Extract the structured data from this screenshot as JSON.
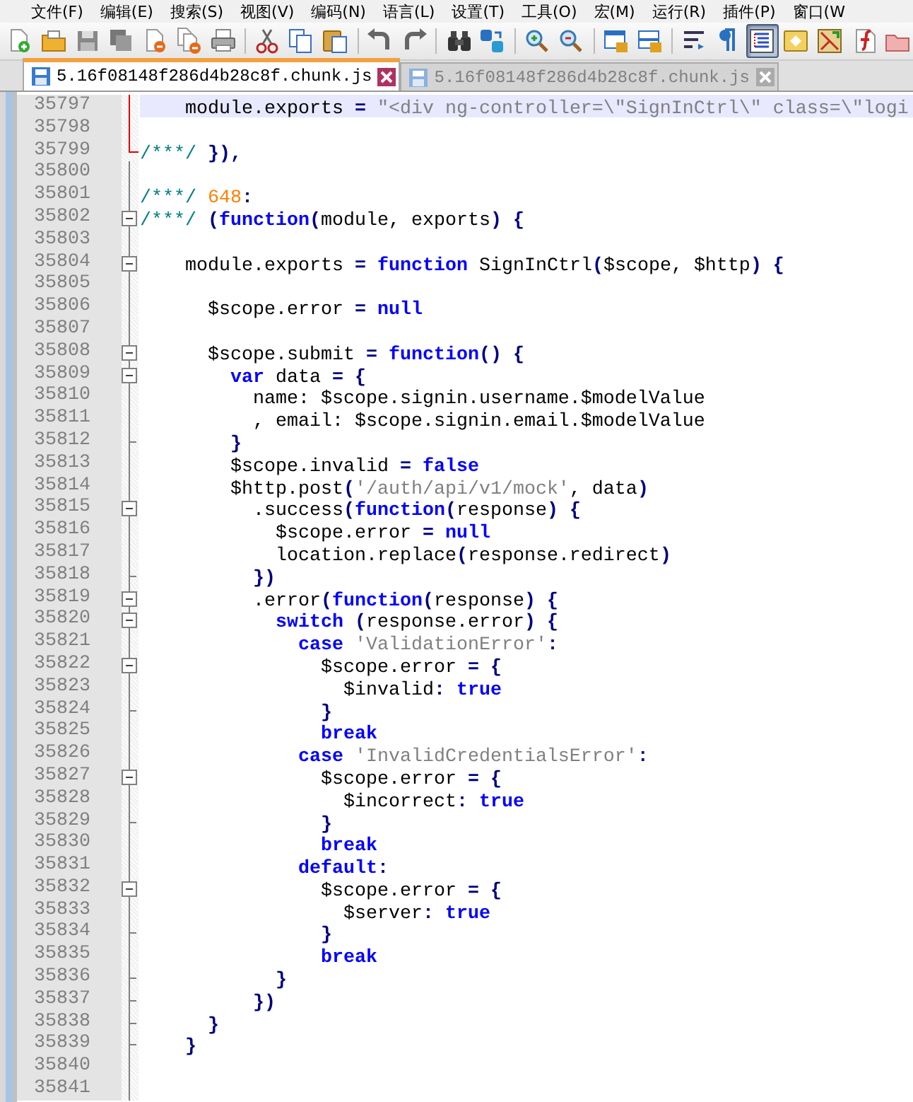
{
  "menu": [
    "文件(F)",
    "编辑(E)",
    "搜索(S)",
    "视图(V)",
    "编码(N)",
    "语言(L)",
    "设置(T)",
    "工具(O)",
    "宏(M)",
    "运行(R)",
    "插件(P)",
    "窗口(W"
  ],
  "toolbar": [
    {
      "kind": "new",
      "on": false
    },
    {
      "kind": "open",
      "on": false
    },
    {
      "kind": "save",
      "on": false
    },
    {
      "kind": "save_all",
      "on": false
    },
    {
      "kind": "close",
      "on": false
    },
    {
      "kind": "close_all",
      "on": false
    },
    {
      "kind": "print",
      "on": false
    },
    {
      "kind": "sep"
    },
    {
      "kind": "cut",
      "on": false
    },
    {
      "kind": "copy",
      "on": false
    },
    {
      "kind": "paste",
      "on": false
    },
    {
      "kind": "sep"
    },
    {
      "kind": "undo",
      "on": false
    },
    {
      "kind": "redo",
      "on": false
    },
    {
      "kind": "sep"
    },
    {
      "kind": "find",
      "on": false
    },
    {
      "kind": "replace",
      "on": false
    },
    {
      "kind": "sep"
    },
    {
      "kind": "zoom_in",
      "on": false
    },
    {
      "kind": "zoom_out",
      "on": false
    },
    {
      "kind": "sep"
    },
    {
      "kind": "sync_v",
      "on": false
    },
    {
      "kind": "sync_h",
      "on": false
    },
    {
      "kind": "sep"
    },
    {
      "kind": "wrap",
      "on": false
    },
    {
      "kind": "pilcrow",
      "on": false
    },
    {
      "kind": "guide",
      "on": true
    },
    {
      "kind": "macro",
      "on": false
    },
    {
      "kind": "map",
      "on": false
    },
    {
      "kind": "func",
      "on": false
    },
    {
      "kind": "folder",
      "on": false
    }
  ],
  "tabs": [
    {
      "label": "5.16f08148f286d4b28c8f.chunk.js",
      "selected": true
    },
    {
      "label": "5.16f08148f286d4b28c8f.chunk.js",
      "selected": false
    }
  ],
  "lines": [
    {
      "number": "35797",
      "kind": "changed",
      "current": true,
      "tokens": [
        {
          "kind": "plain",
          "text": "    module.exports "
        },
        {
          "kind": "operator",
          "text": "= "
        },
        {
          "kind": "string",
          "text": "\"<div ng-controller=\\\"SignInCtrl\\\" class=\\\"logi"
        }
      ]
    },
    {
      "number": "35798",
      "kind": "changed",
      "current": false
    },
    {
      "number": "35799",
      "kind": "changed_end",
      "current": false,
      "tokens": [
        {
          "kind": "comment",
          "text": "/***/ "
        },
        {
          "kind": "operator",
          "text": "}),"
        }
      ]
    },
    {
      "number": "35800",
      "kind": "plain",
      "current": false
    },
    {
      "number": "35801",
      "kind": "plain",
      "current": false,
      "tokens": [
        {
          "kind": "comment",
          "text": "/***/ "
        },
        {
          "kind": "number",
          "text": "648"
        },
        {
          "kind": "operator",
          "text": ":"
        }
      ]
    },
    {
      "number": "35802",
      "kind": "fold_start",
      "current": false,
      "tokens": [
        {
          "kind": "comment",
          "text": "/***/ "
        },
        {
          "kind": "operator",
          "text": "("
        },
        {
          "kind": "keyword",
          "text": "function"
        },
        {
          "kind": "operator",
          "text": "("
        },
        {
          "kind": "plain",
          "text": "module, exports"
        },
        {
          "kind": "operator",
          "text": ") {"
        }
      ]
    },
    {
      "number": "35803",
      "kind": "plain",
      "current": false
    },
    {
      "number": "35804",
      "kind": "fold_start",
      "current": false,
      "tokens": [
        {
          "kind": "plain",
          "text": "    module.exports "
        },
        {
          "kind": "operator",
          "text": "= "
        },
        {
          "kind": "keyword",
          "text": "function"
        },
        {
          "kind": "plain",
          "text": " SignInCtrl"
        },
        {
          "kind": "operator",
          "text": "("
        },
        {
          "kind": "plain",
          "text": "$scope, $http"
        },
        {
          "kind": "operator",
          "text": ") {"
        }
      ]
    },
    {
      "number": "35805",
      "kind": "plain",
      "current": false
    },
    {
      "number": "35806",
      "kind": "plain",
      "current": false,
      "tokens": [
        {
          "kind": "plain",
          "text": "      $scope.error "
        },
        {
          "kind": "operator",
          "text": "= "
        },
        {
          "kind": "keyword",
          "text": "null"
        }
      ]
    },
    {
      "number": "35807",
      "kind": "plain",
      "current": false
    },
    {
      "number": "35808",
      "kind": "fold_start",
      "current": false,
      "tokens": [
        {
          "kind": "plain",
          "text": "      $scope.submit "
        },
        {
          "kind": "operator",
          "text": "= "
        },
        {
          "kind": "keyword",
          "text": "function"
        },
        {
          "kind": "operator",
          "text": "() {"
        }
      ]
    },
    {
      "number": "35809",
      "kind": "fold_start",
      "current": false,
      "tokens": [
        {
          "kind": "keyword",
          "text": "        var"
        },
        {
          "kind": "plain",
          "text": " data "
        },
        {
          "kind": "operator",
          "text": "= {"
        }
      ]
    },
    {
      "number": "35810",
      "kind": "plain",
      "current": false,
      "tokens": [
        {
          "kind": "plain",
          "text": "          name: $scope.signin.username.$modelValue"
        }
      ]
    },
    {
      "number": "35811",
      "kind": "plain",
      "current": false,
      "tokens": [
        {
          "kind": "plain",
          "text": "          , email: $scope.signin.email.$modelValue"
        }
      ]
    },
    {
      "number": "35812",
      "kind": "fold_end",
      "current": false,
      "tokens": [
        {
          "kind": "operator",
          "text": "        }"
        }
      ]
    },
    {
      "number": "35813",
      "kind": "plain",
      "current": false,
      "tokens": [
        {
          "kind": "plain",
          "text": "        $scope.invalid "
        },
        {
          "kind": "operator",
          "text": "= "
        },
        {
          "kind": "keyword",
          "text": "false"
        }
      ]
    },
    {
      "number": "35814",
      "kind": "plain",
      "current": false,
      "tokens": [
        {
          "kind": "plain",
          "text": "        $http.post"
        },
        {
          "kind": "operator",
          "text": "("
        },
        {
          "kind": "string",
          "text": "'/auth/api/v1/mock'"
        },
        {
          "kind": "plain",
          "text": ", data"
        },
        {
          "kind": "operator",
          "text": ")"
        }
      ]
    },
    {
      "number": "35815",
      "kind": "fold_start",
      "current": false,
      "tokens": [
        {
          "kind": "plain",
          "text": "          .success"
        },
        {
          "kind": "operator",
          "text": "("
        },
        {
          "kind": "keyword",
          "text": "function"
        },
        {
          "kind": "operator",
          "text": "("
        },
        {
          "kind": "plain",
          "text": "response"
        },
        {
          "kind": "operator",
          "text": ") {"
        }
      ]
    },
    {
      "number": "35816",
      "kind": "plain",
      "current": false,
      "tokens": [
        {
          "kind": "plain",
          "text": "            $scope.error "
        },
        {
          "kind": "operator",
          "text": "= "
        },
        {
          "kind": "keyword",
          "text": "null"
        }
      ]
    },
    {
      "number": "35817",
      "kind": "plain",
      "current": false,
      "tokens": [
        {
          "kind": "plain",
          "text": "            location.replace"
        },
        {
          "kind": "operator",
          "text": "("
        },
        {
          "kind": "plain",
          "text": "response.redirect"
        },
        {
          "kind": "operator",
          "text": ")"
        }
      ]
    },
    {
      "number": "35818",
      "kind": "fold_end",
      "current": false,
      "tokens": [
        {
          "kind": "operator",
          "text": "          })"
        }
      ]
    },
    {
      "number": "35819",
      "kind": "fold_start",
      "current": false,
      "tokens": [
        {
          "kind": "plain",
          "text": "          .error"
        },
        {
          "kind": "operator",
          "text": "("
        },
        {
          "kind": "keyword",
          "text": "function"
        },
        {
          "kind": "operator",
          "text": "("
        },
        {
          "kind": "plain",
          "text": "response"
        },
        {
          "kind": "operator",
          "text": ") {"
        }
      ]
    },
    {
      "number": "35820",
      "kind": "fold_start",
      "current": false,
      "tokens": [
        {
          "kind": "keyword",
          "text": "            switch"
        },
        {
          "kind": "operator",
          "text": " ("
        },
        {
          "kind": "plain",
          "text": "response.error"
        },
        {
          "kind": "operator",
          "text": ") {"
        }
      ]
    },
    {
      "number": "35821",
      "kind": "plain",
      "current": false,
      "tokens": [
        {
          "kind": "keyword",
          "text": "              case"
        },
        {
          "kind": "string",
          "text": " 'ValidationError'"
        },
        {
          "kind": "operator",
          "text": ":"
        }
      ]
    },
    {
      "number": "35822",
      "kind": "fold_start",
      "current": false,
      "tokens": [
        {
          "kind": "plain",
          "text": "                $scope.error "
        },
        {
          "kind": "operator",
          "text": "= {"
        }
      ]
    },
    {
      "number": "35823",
      "kind": "plain",
      "current": false,
      "tokens": [
        {
          "kind": "plain",
          "text": "                  $invalid"
        },
        {
          "kind": "operator",
          "text": ": "
        },
        {
          "kind": "keyword",
          "text": "true"
        }
      ]
    },
    {
      "number": "35824",
      "kind": "fold_end",
      "current": false,
      "tokens": [
        {
          "kind": "operator",
          "text": "                }"
        }
      ]
    },
    {
      "number": "35825",
      "kind": "plain",
      "current": false,
      "tokens": [
        {
          "kind": "keyword",
          "text": "                break"
        }
      ]
    },
    {
      "number": "35826",
      "kind": "plain",
      "current": false,
      "tokens": [
        {
          "kind": "keyword",
          "text": "              case"
        },
        {
          "kind": "string",
          "text": " 'InvalidCredentialsError'"
        },
        {
          "kind": "operator",
          "text": ":"
        }
      ]
    },
    {
      "number": "35827",
      "kind": "fold_start",
      "current": false,
      "tokens": [
        {
          "kind": "plain",
          "text": "                $scope.error "
        },
        {
          "kind": "operator",
          "text": "= {"
        }
      ]
    },
    {
      "number": "35828",
      "kind": "plain",
      "current": false,
      "tokens": [
        {
          "kind": "plain",
          "text": "                  $incorrect"
        },
        {
          "kind": "operator",
          "text": ": "
        },
        {
          "kind": "keyword",
          "text": "true"
        }
      ]
    },
    {
      "number": "35829",
      "kind": "fold_end",
      "current": false,
      "tokens": [
        {
          "kind": "operator",
          "text": "                }"
        }
      ]
    },
    {
      "number": "35830",
      "kind": "plain",
      "current": false,
      "tokens": [
        {
          "kind": "keyword",
          "text": "                break"
        }
      ]
    },
    {
      "number": "35831",
      "kind": "plain",
      "current": false,
      "tokens": [
        {
          "kind": "keyword",
          "text": "              default"
        },
        {
          "kind": "operator",
          "text": ":"
        }
      ]
    },
    {
      "number": "35832",
      "kind": "fold_start",
      "current": false,
      "tokens": [
        {
          "kind": "plain",
          "text": "                $scope.error "
        },
        {
          "kind": "operator",
          "text": "= {"
        }
      ]
    },
    {
      "number": "35833",
      "kind": "plain",
      "current": false,
      "tokens": [
        {
          "kind": "plain",
          "text": "                  $server"
        },
        {
          "kind": "operator",
          "text": ": "
        },
        {
          "kind": "keyword",
          "text": "true"
        }
      ]
    },
    {
      "number": "35834",
      "kind": "fold_end",
      "current": false,
      "tokens": [
        {
          "kind": "operator",
          "text": "                }"
        }
      ]
    },
    {
      "number": "35835",
      "kind": "plain",
      "current": false,
      "tokens": [
        {
          "kind": "keyword",
          "text": "                break"
        }
      ]
    },
    {
      "number": "35836",
      "kind": "fold_end",
      "current": false,
      "tokens": [
        {
          "kind": "operator",
          "text": "            }"
        }
      ]
    },
    {
      "number": "35837",
      "kind": "fold_end",
      "current": false,
      "tokens": [
        {
          "kind": "operator",
          "text": "          })"
        }
      ]
    },
    {
      "number": "35838",
      "kind": "fold_end",
      "current": false,
      "tokens": [
        {
          "kind": "operator",
          "text": "      }"
        }
      ]
    },
    {
      "number": "35839",
      "kind": "fold_end",
      "current": false,
      "tokens": [
        {
          "kind": "operator",
          "text": "    }"
        }
      ]
    },
    {
      "number": "35840",
      "kind": "plain",
      "current": false
    },
    {
      "number": "35841",
      "kind": "plain",
      "current": false
    }
  ]
}
